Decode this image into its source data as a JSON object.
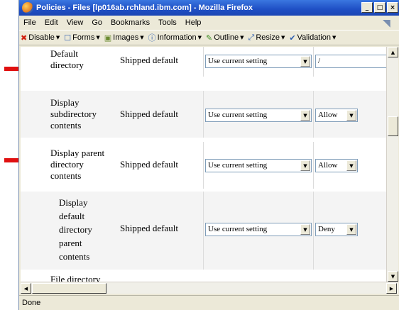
{
  "window": {
    "title": "Policies - Files [lp016ab.rchland.ibm.com] - Mozilla Firefox",
    "min": "_",
    "max": "□",
    "close": "×"
  },
  "menu": [
    "File",
    "Edit",
    "View",
    "Go",
    "Bookmarks",
    "Tools",
    "Help"
  ],
  "toolbar": [
    {
      "icon": "x-icon",
      "glyph": "✖",
      "color": "#d02010",
      "label": "Disable"
    },
    {
      "icon": "forms-icon",
      "glyph": "☐",
      "color": "#2a5cb0",
      "label": "Forms"
    },
    {
      "icon": "images-icon",
      "glyph": "▣",
      "color": "#6a8a30",
      "label": "Images"
    },
    {
      "icon": "info-icon",
      "glyph": "ⓘ",
      "color": "#2a5cb0",
      "label": "Information"
    },
    {
      "icon": "pencil-icon",
      "glyph": "✎",
      "color": "#3a8a20",
      "label": "Outline"
    },
    {
      "icon": "resize-icon",
      "glyph": "⤢",
      "color": "#2a5cb0",
      "label": "Resize"
    },
    {
      "icon": "check-icon",
      "glyph": "✔",
      "color": "#2a5cb0",
      "label": "Validation"
    }
  ],
  "rows": [
    {
      "name": "Default directory",
      "lines": [
        "Default",
        "directory"
      ],
      "source": "Shipped default",
      "setting": "Use current setting",
      "value": "/",
      "valueType": "text"
    },
    {
      "name": "Display subdirectory contents",
      "lines": [
        "Display",
        "subdirectory",
        "contents"
      ],
      "source": "Shipped default",
      "setting": "Use current setting",
      "value": "Allow",
      "valueType": "select"
    },
    {
      "name": "Display parent directory contents",
      "lines": [
        "Display parent",
        "directory",
        "contents"
      ],
      "source": "Shipped default",
      "setting": "Use current setting",
      "value": "Allow",
      "valueType": "select"
    },
    {
      "name": "Display default directory parent contents",
      "lines": [
        "Display",
        "default",
        "directory",
        "parent",
        "contents"
      ],
      "source": "Shipped default",
      "setting": "Use current setting",
      "value": "Deny",
      "valueType": "select"
    },
    {
      "name": "File directory",
      "lines": [
        "File directory"
      ]
    }
  ],
  "status": "Done",
  "colors": {
    "arrow": "#e01010",
    "titlebar": "#1f4fc4"
  }
}
